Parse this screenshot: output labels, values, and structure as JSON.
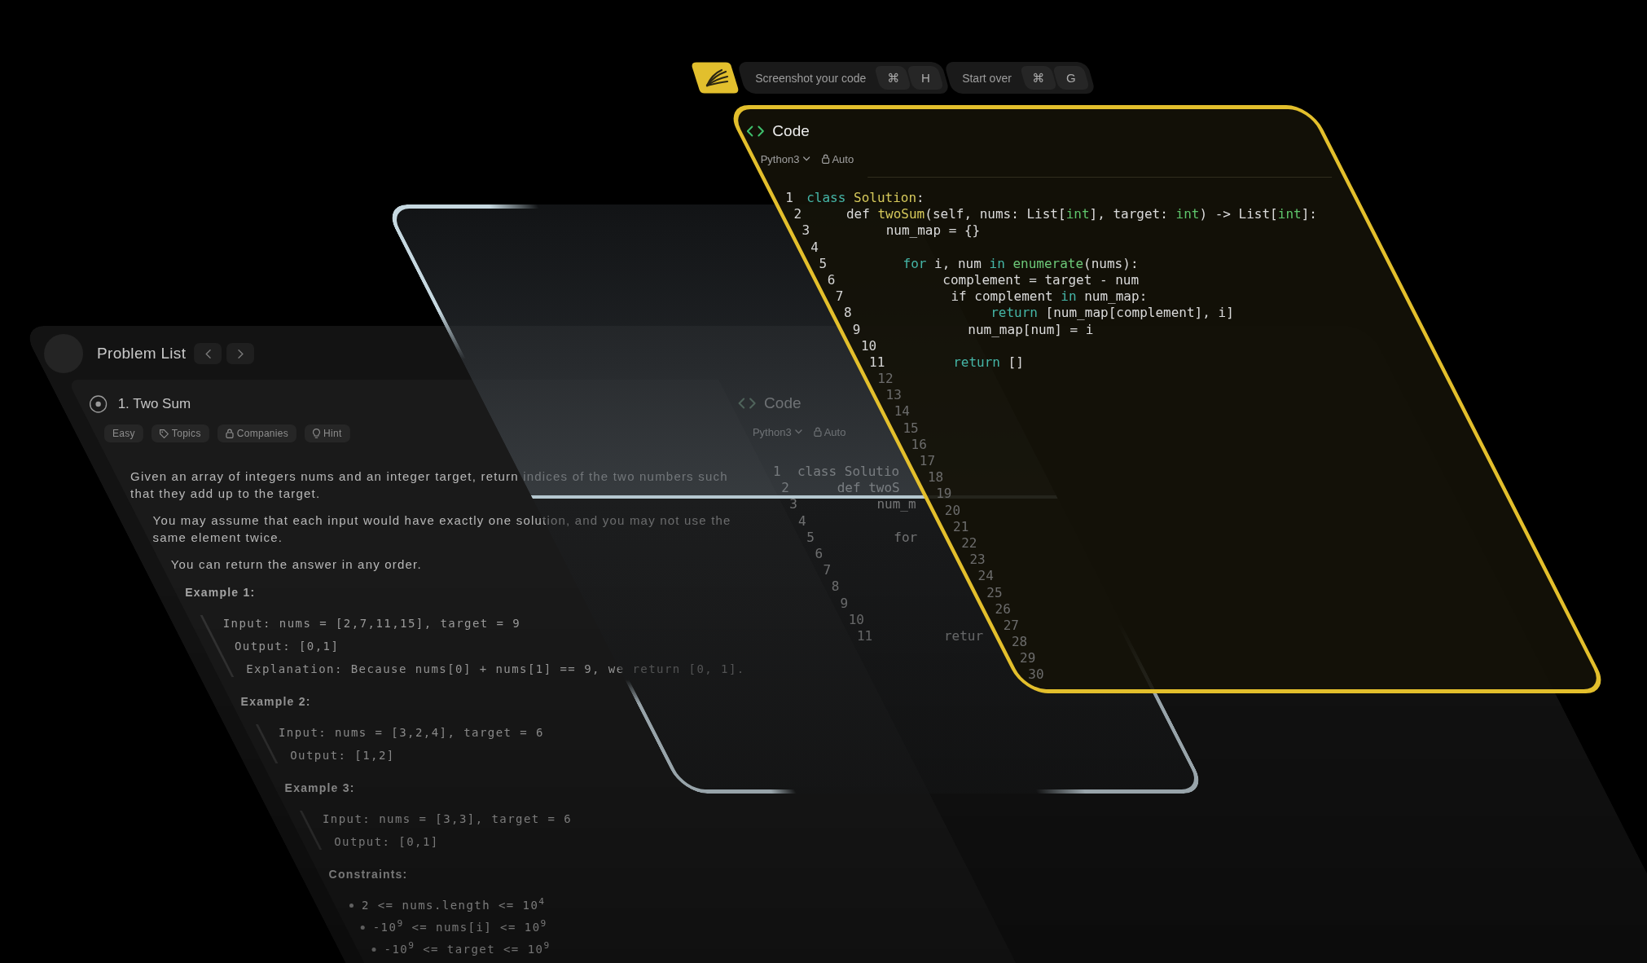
{
  "toolbar": {
    "buttons": [
      {
        "label": "Screenshot your code",
        "keys": [
          "⌘",
          "H"
        ]
      },
      {
        "label": "Start over",
        "keys": [
          "⌘",
          "G"
        ]
      }
    ]
  },
  "code_panel": {
    "title": "Code",
    "language": "Python3",
    "mode": "Auto",
    "lines": [
      {
        "number": "1",
        "tokens": [
          {
            "kind": "keyword",
            "text": "class"
          },
          {
            "kind": "function",
            "text": " Solution"
          },
          {
            "kind": "plain",
            "text": ":"
          }
        ],
        "children": [
          {
            "number": "2",
            "tokens": [
              {
                "kind": "plain",
                "text": "def "
              },
              {
                "kind": "function",
                "text": "twoSum"
              },
              {
                "kind": "plain",
                "text": "(self, nums: List["
              },
              {
                "kind": "type",
                "text": "int"
              },
              {
                "kind": "plain",
                "text": "], target: "
              },
              {
                "kind": "type",
                "text": "int"
              },
              {
                "kind": "plain",
                "text": ") -> List["
              },
              {
                "kind": "type",
                "text": "int"
              },
              {
                "kind": "plain",
                "text": "]:"
              }
            ],
            "children": [
              {
                "number": "3",
                "tokens": [
                  {
                    "kind": "plain",
                    "text": "num_map = {}"
                  }
                ]
              },
              {
                "number": "4"
              },
              {
                "number": "5",
                "tokens": [
                  {
                    "kind": "keyword",
                    "text": "for"
                  },
                  {
                    "kind": "plain",
                    "text": " i, num "
                  },
                  {
                    "kind": "keyword",
                    "text": "in"
                  },
                  {
                    "kind": "builtin",
                    "text": " enumerate"
                  },
                  {
                    "kind": "plain",
                    "text": "(nums):"
                  }
                ],
                "children": [
                  {
                    "number": "6",
                    "tokens": [
                      {
                        "kind": "plain",
                        "text": "complement = target - num"
                      }
                    ]
                  },
                  {
                    "number": "7",
                    "tokens": [
                      {
                        "kind": "plain",
                        "text": "if complement "
                      },
                      {
                        "kind": "keyword",
                        "text": "in"
                      },
                      {
                        "kind": "plain",
                        "text": " num_map:"
                      }
                    ],
                    "children": [
                      {
                        "number": "8",
                        "tokens": [
                          {
                            "kind": "keyword",
                            "text": "return"
                          },
                          {
                            "kind": "plain",
                            "text": " [num_map[complement], i]"
                          }
                        ]
                      }
                    ]
                  },
                  {
                    "number": "9",
                    "tokens": [
                      {
                        "kind": "plain",
                        "text": "num_map[num] = i"
                      }
                    ]
                  }
                ]
              },
              {
                "number": "10"
              },
              {
                "number": "11",
                "tokens": [
                  {
                    "kind": "keyword",
                    "text": "return"
                  },
                  {
                    "kind": "plain",
                    "text": " []"
                  }
                ]
              }
            ]
          }
        ]
      }
    ],
    "blank_lines": [
      "12",
      "13",
      "14",
      "15",
      "16",
      "17",
      "18",
      "19",
      "20",
      "21",
      "22",
      "23",
      "24",
      "25",
      "26",
      "27",
      "28",
      "29",
      "30"
    ]
  },
  "problem_page": {
    "header": {
      "title": "Problem List"
    },
    "problem": {
      "title": "1. Two Sum",
      "tags": [
        {
          "kind": "difficulty",
          "label": "Easy"
        },
        {
          "kind": "topics",
          "label": "Topics"
        },
        {
          "kind": "companies",
          "label": "Companies"
        },
        {
          "kind": "hint",
          "label": "Hint"
        }
      ],
      "paragraphs": [
        "Given an array of integers nums and an integer target, return indices of the two numbers such that they add up to the target.",
        "You may assume that each input would have exactly one solution, and you may not use the same element twice.",
        "You can return the answer in any order."
      ],
      "examples": [
        {
          "heading": "Example 1:",
          "lines": [
            "Input: nums = [2,7,11,15], target = 9",
            "Output: [0,1]",
            "Explanation: Because nums[0] + nums[1] == 9, we return [0, 1]."
          ]
        },
        {
          "heading": "Example 2:",
          "lines": [
            "Input: nums = [3,2,4], target = 6",
            "Output: [1,2]"
          ]
        },
        {
          "heading": "Example 3:",
          "lines": [
            "Input: nums = [3,3], target = 6",
            "Output: [0,1]"
          ]
        }
      ],
      "constraints_heading": "Constraints:",
      "constraints": [
        "2 <= nums.length <= 10$^{4}$",
        "-10$^{9}$ <= nums[i] <= 10$^{9}$",
        "-10$^{9}$ <= target <= 10$^{9}$"
      ]
    },
    "editor": {
      "title": "Code",
      "language": "Python3",
      "mode": "Auto",
      "lines": [
        {
          "number": "1",
          "text": "class Solutio",
          "children": [
            {
              "number": "2",
              "text": "def twoS",
              "children": [
                {
                  "number": "3",
                  "text": "num_m"
                },
                {
                  "number": "4"
                },
                {
                  "number": "5",
                  "text": "for",
                  "children": [
                    {
                      "number": "6"
                    },
                    {
                      "number": "7",
                      "children": [
                        {
                          "number": "8"
                        }
                      ]
                    },
                    {
                      "number": "9"
                    }
                  ]
                },
                {
                  "number": "10"
                },
                {
                  "number": "11",
                  "text": "retur"
                }
              ]
            }
          ]
        }
      ]
    }
  }
}
